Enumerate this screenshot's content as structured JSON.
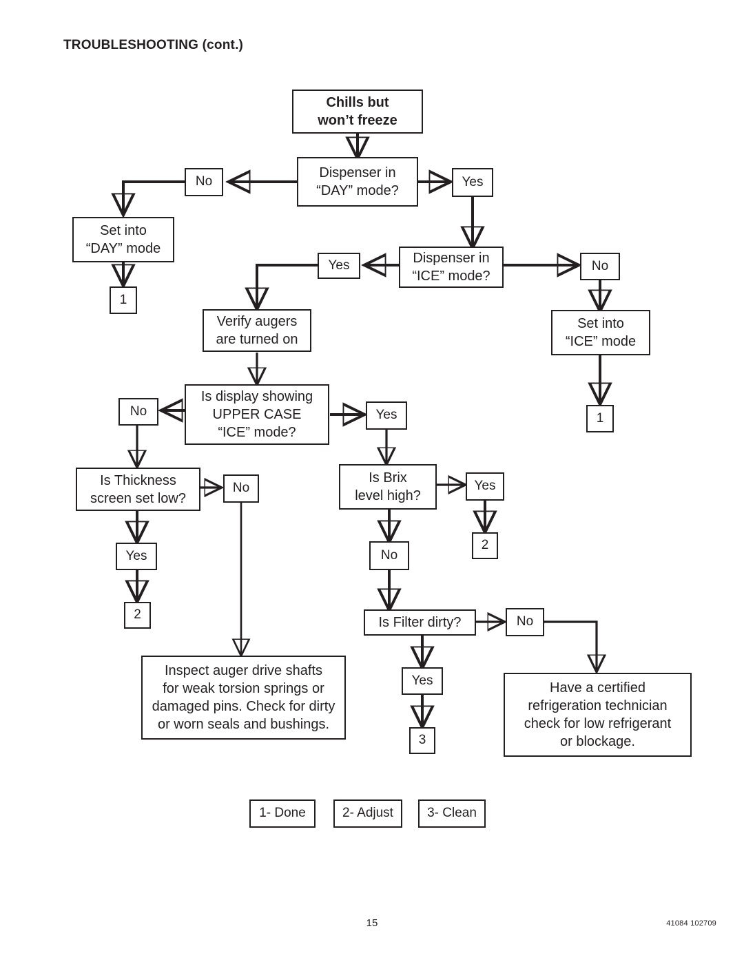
{
  "document": {
    "heading": "TROUBLESHOOTING (cont.)",
    "page_number": "15",
    "doc_code": "41084 102709"
  },
  "flowchart": {
    "title": "Chills but won't freeze troubleshooting",
    "nodes": {
      "start": "Chills but\nwon’t freeze",
      "q_day_mode": "Dispenser in\n“DAY” mode?",
      "day_no": "No",
      "day_yes": "Yes",
      "set_day_mode": "Set into\n“DAY” mode",
      "term_day_1": "1",
      "q_ice_mode": "Dispenser in\n“ICE” mode?",
      "ice_yes": "Yes",
      "ice_no": "No",
      "set_ice_mode": "Set into\n“ICE” mode",
      "term_ice_1": "1",
      "verify_augers": "Verify augers\nare turned on",
      "q_display": "Is display showing\nUPPER CASE\n“ICE” mode?",
      "display_no": "No",
      "display_yes": "Yes",
      "q_thickness": "Is Thickness\nscreen set low?",
      "thickness_no": "No",
      "thickness_yes": "Yes",
      "term_thickness_2": "2",
      "q_brix": "Is Brix\nlevel high?",
      "brix_yes": "Yes",
      "brix_no": "No",
      "term_brix_2": "2",
      "q_filter": "Is Filter dirty?",
      "filter_no": "No",
      "filter_yes": "Yes",
      "term_filter_3": "3",
      "inspect_augers": "Inspect auger drive shafts\nfor weak torsion springs or\ndamaged pins. Check for dirty\nor worn seals and bushings.",
      "certified_tech": "Have a certified\nrefrigeration technician\ncheck for low refrigerant\nor blockage."
    }
  },
  "legend": {
    "items": [
      {
        "label": "1- Done"
      },
      {
        "label": "2- Adjust"
      },
      {
        "label": "3- Clean"
      }
    ]
  }
}
